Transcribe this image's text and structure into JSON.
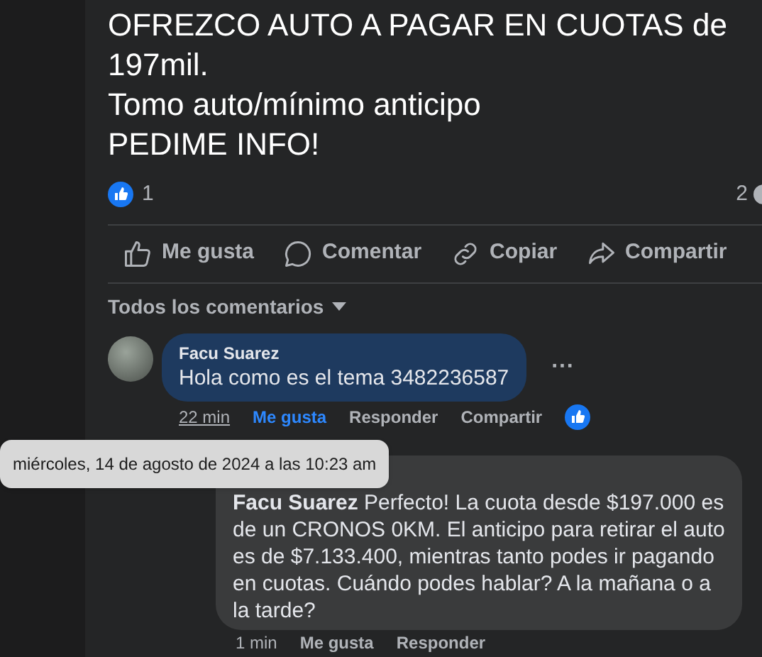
{
  "post": {
    "title_lines": [
      "OFREZCO AUTO A PAGAR EN CUOTAS de",
      "197mil.",
      "Tomo auto/mínimo anticipo",
      "PEDIME INFO!"
    ],
    "like_count": "1",
    "comment_count": "2"
  },
  "actions": [
    {
      "kind": "like",
      "label": "Me gusta"
    },
    {
      "kind": "comment",
      "label": "Comentar"
    },
    {
      "kind": "link",
      "label": "Copiar"
    },
    {
      "kind": "share",
      "label": "Compartir"
    }
  ],
  "comments_filter": "Todos los comentarios",
  "comment": {
    "author": "Facu Suarez",
    "text": "Hola como es el tema 3482236587",
    "more": "···",
    "time": "22 min",
    "actions": [
      {
        "label": "Me gusta",
        "selected": true
      },
      {
        "label": "Responder",
        "selected": false
      },
      {
        "label": "Compartir",
        "selected": false
      }
    ]
  },
  "reply": {
    "mention": "Facu Suarez",
    "text": "Perfecto! La cuota desde $197.000 es de un CRONOS 0KM. El anticipo para retirar el auto es de $7.133.400, mientras tanto podes ir pagando en cuotas. Cuándo podes hablar? A la mañana o a la tarde?",
    "time": "1 min",
    "actions": [
      {
        "label": "Me gusta"
      },
      {
        "label": "Responder"
      }
    ]
  },
  "tooltip": "miércoles, 14 de agosto de 2024 a las 10:23 am"
}
